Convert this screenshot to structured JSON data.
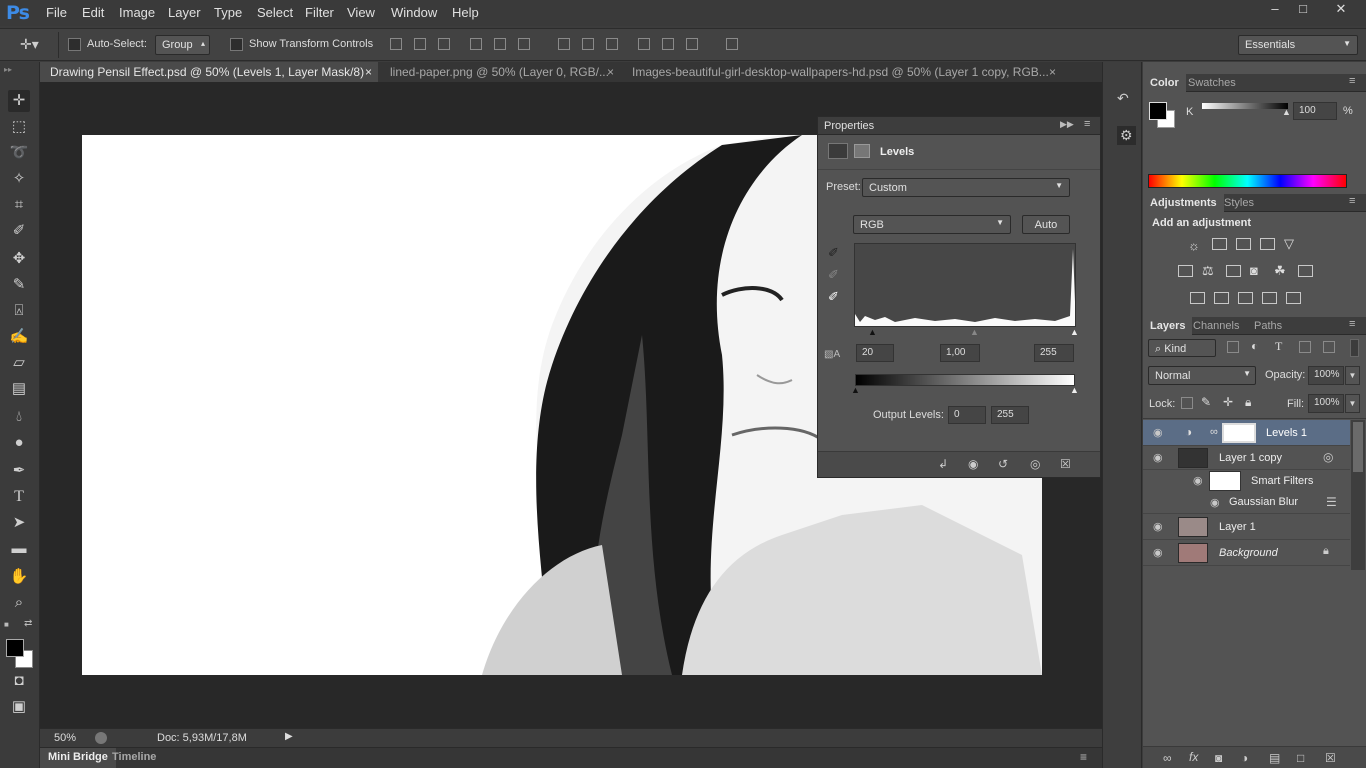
{
  "app": {
    "logo": "Ps"
  },
  "menu": [
    "File",
    "Edit",
    "Image",
    "Layer",
    "Type",
    "Select",
    "Filter",
    "View",
    "Window",
    "Help"
  ],
  "window_controls": {
    "minimize": "–",
    "restore": "□",
    "close": "✕"
  },
  "options": {
    "auto_select_label": "Auto-Select:",
    "auto_select_value": "Group",
    "show_transform_label": "Show Transform Controls",
    "workspace": "Essentials"
  },
  "tabs": [
    {
      "label": "Drawing Pensil Effect.psd @ 50% (Levels 1, Layer Mask/8) *",
      "close": "×"
    },
    {
      "label": "lined-paper.png @ 50% (Layer 0, RGB/...",
      "close": "×"
    },
    {
      "label": "Images-beautiful-girl-desktop-wallpapers-hd.psd @ 50% (Layer 1 copy, RGB...",
      "close": "×"
    }
  ],
  "properties": {
    "title": "Properties",
    "adjustment": "Levels",
    "preset_label": "Preset:",
    "preset_value": "Custom",
    "channel": "RGB",
    "auto_button": "Auto",
    "input_black": "20",
    "input_gamma": "1,00",
    "input_white": "255",
    "output_label": "Output Levels:",
    "output_black": "0",
    "output_white": "255"
  },
  "status": {
    "zoom": "50%",
    "doc": "Doc: 5,93M/17,8M"
  },
  "bottom_tabs": {
    "mini_bridge": "Mini Bridge",
    "timeline": "Timeline"
  },
  "color_panel": {
    "tabs": [
      "Color",
      "Swatches"
    ],
    "channel": "K",
    "value": "100",
    "unit": "%"
  },
  "adjustments_panel": {
    "tabs": [
      "Adjustments",
      "Styles"
    ],
    "heading": "Add an adjustment"
  },
  "layers_panel": {
    "tabs": [
      "Layers",
      "Channels",
      "Paths"
    ],
    "filter_kind": "Kind",
    "blend_mode": "Normal",
    "opacity_label": "Opacity:",
    "opacity_value": "100%",
    "lock_label": "Lock:",
    "fill_label": "Fill:",
    "fill_value": "100%",
    "layers": [
      {
        "name": "Levels 1"
      },
      {
        "name": "Layer 1 copy"
      },
      {
        "name": "Smart Filters"
      },
      {
        "name": "Gaussian Blur"
      },
      {
        "name": "Layer 1"
      },
      {
        "name": "Background"
      }
    ],
    "footer_fx": "fx"
  },
  "colors": {
    "accent": "#3d8be6",
    "selected_layer": "#5b6d86"
  }
}
